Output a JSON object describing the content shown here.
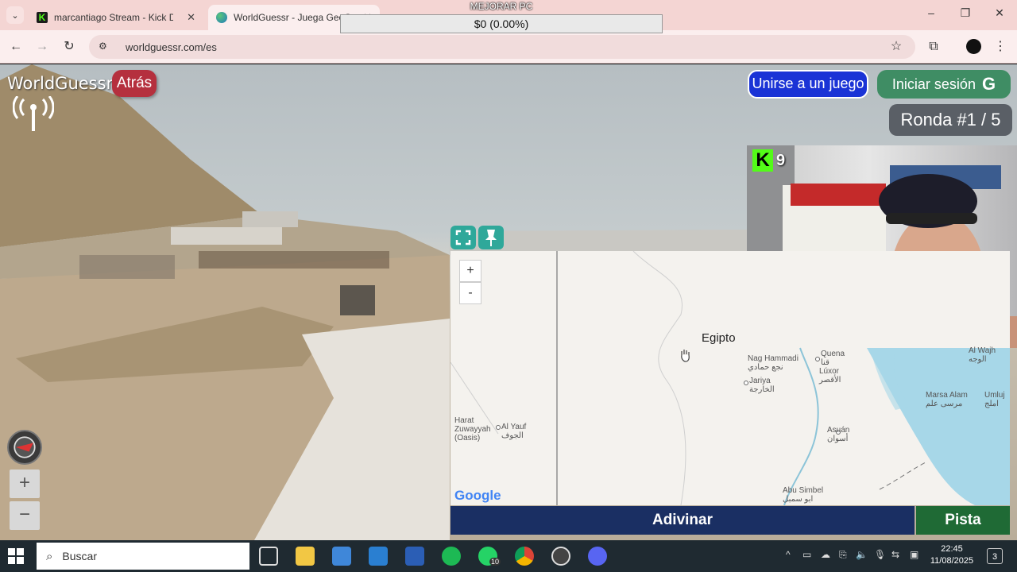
{
  "browser": {
    "tabs": [
      {
        "title": "marcantiago Stream - Kick Dash",
        "close": "✕"
      },
      {
        "title": "WorldGuessr - Juega GeoGuessr",
        "close": "✕"
      }
    ],
    "url": "worldguessr.com/es"
  },
  "overlay": {
    "title": "MEJORAR PC",
    "amount": "$0 (0.00%)"
  },
  "game": {
    "logo": "WorldGuessr",
    "back_label": "Atrás",
    "join_label": "Unirse a un juego",
    "signin_label": "Iniciar sesión",
    "signin_icon": "G",
    "round_label": "Ronda #1 / 5",
    "zoom_in": "+",
    "zoom_out": "−",
    "guess_label": "Adivinar",
    "hint_label": "Pista"
  },
  "map": {
    "zoom_in": "+",
    "zoom_out": "-",
    "country_label": "Egipto",
    "places": [
      {
        "name": "Quena",
        "alt": "قنا"
      },
      {
        "name": "Nag Hammadi",
        "alt": "نجع حمادي"
      },
      {
        "name": "Lúxor",
        "alt": "الأقصر"
      },
      {
        "name": "Jariya",
        "alt": "الخارجة"
      },
      {
        "name": "Asuán",
        "alt": "أسوان"
      },
      {
        "name": "Marsa Alam",
        "alt": "مرسى علم"
      },
      {
        "name": "Umluj",
        "alt": "املج"
      },
      {
        "name": "Al Wajh",
        "alt": "الوجه"
      },
      {
        "name": "Abu Simbel",
        "alt": "ابو سمبل"
      },
      {
        "name": "Harat Zuwayyah (Oasis)",
        "alt": ""
      },
      {
        "name": "Al Yauf",
        "alt": "الجوف"
      }
    ],
    "attribution": "Google",
    "colors": {
      "land": "#f4f2ee",
      "sea": "#a7d7e8",
      "border": "#8f8f8f"
    }
  },
  "webcam": {
    "badge_icon": "K",
    "viewer_count": "9"
  },
  "taskbar": {
    "search_placeholder": "Buscar",
    "whatsapp_badge": "10",
    "time": "22:45",
    "date": "11/08/2025",
    "notifications": "3"
  }
}
